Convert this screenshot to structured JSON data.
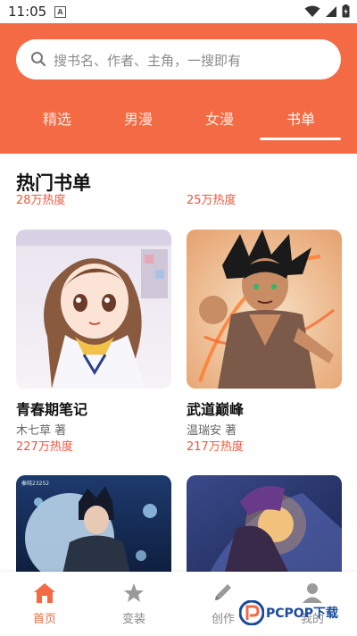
{
  "status_bar": {
    "time": "11:05",
    "notification_glyph": "A"
  },
  "search": {
    "placeholder": "搜书名、作者、主角，一搜即有"
  },
  "tabs": [
    {
      "label": "精选",
      "active": false
    },
    {
      "label": "男漫",
      "active": false
    },
    {
      "label": "女漫",
      "active": false
    },
    {
      "label": "书单",
      "active": true
    }
  ],
  "section": {
    "title": "热门书单",
    "top_heats": [
      "28万热度",
      "25万热度"
    ]
  },
  "books": [
    {
      "title": "青春期笔记",
      "author": "木七草 著",
      "heat": "227万热度"
    },
    {
      "title": "武道巅峰",
      "author": "温瑞安 著",
      "heat": "217万热度"
    },
    {
      "cover_text": "秦晓23252"
    }
  ],
  "bottom_nav": [
    {
      "label": "首页",
      "icon": "home-icon",
      "active": true
    },
    {
      "label": "变装",
      "icon": "star-icon",
      "active": false
    },
    {
      "label": "创作",
      "icon": "pencil-icon",
      "active": false
    },
    {
      "label": "我的",
      "icon": "person-icon",
      "active": false
    }
  ],
  "watermark": {
    "text": "PCPOP下载"
  },
  "colors": {
    "accent": "#f36a44",
    "heat": "#f0553a"
  }
}
